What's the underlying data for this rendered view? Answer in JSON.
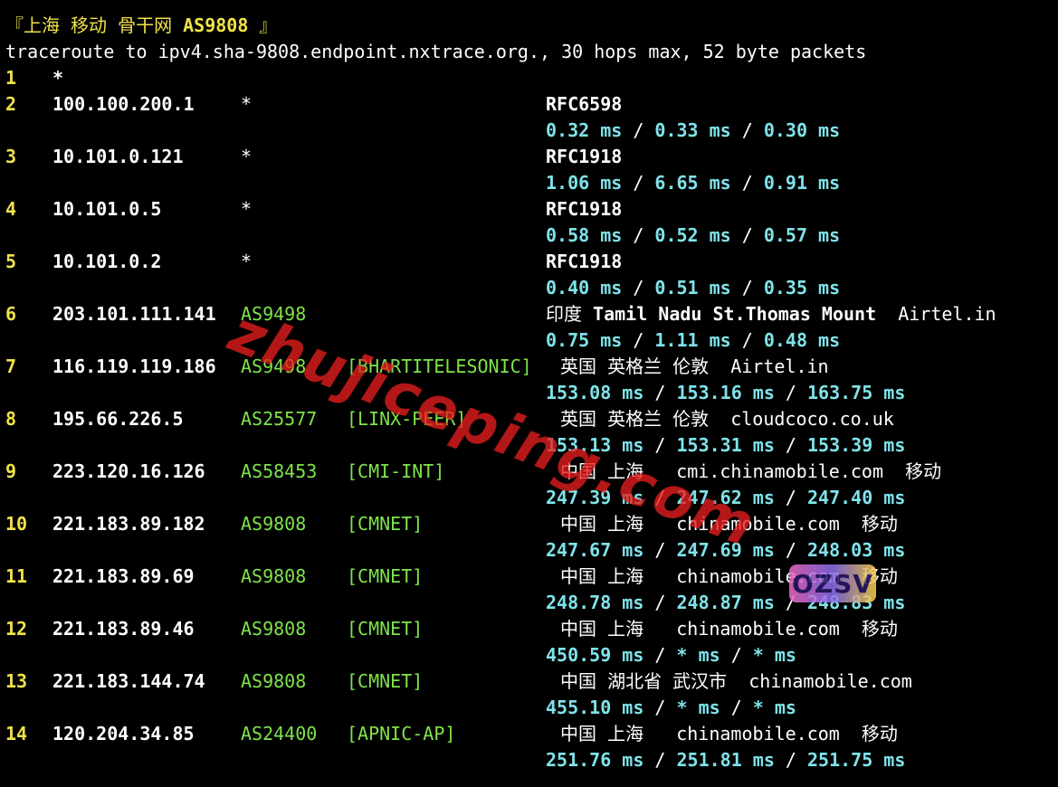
{
  "header": {
    "title_prefix": "『上海 移动 骨干网 ",
    "title_asn": "AS9808",
    "title_suffix": " 』",
    "command": "traceroute to ipv4.sha-9808.endpoint.nxtrace.org., 30 hops max, 52 byte packets"
  },
  "hops": [
    {
      "num": "1",
      "ip": "*"
    },
    {
      "num": "2",
      "ip": "100.100.200.1",
      "star": "*",
      "geo": "RFC6598",
      "t1": "0.32 ms",
      "t2": "0.33 ms",
      "t3": "0.30 ms"
    },
    {
      "num": "3",
      "ip": "10.101.0.121",
      "star": "*",
      "geo": "RFC1918",
      "t1": "1.06 ms",
      "t2": "6.65 ms",
      "t3": "0.91 ms"
    },
    {
      "num": "4",
      "ip": "10.101.0.5",
      "star": "*",
      "geo": "RFC1918",
      "t1": "0.58 ms",
      "t2": "0.52 ms",
      "t3": "0.57 ms"
    },
    {
      "num": "5",
      "ip": "10.101.0.2",
      "star": "*",
      "geo": "RFC1918",
      "t1": "0.40 ms",
      "t2": "0.51 ms",
      "t3": "0.35 ms"
    },
    {
      "num": "6",
      "ip": "203.101.111.141",
      "asn": "AS9498",
      "geo_a": "印度 ",
      "geo_b": "Tamil Nadu St.Thomas Mount",
      "geo_c": "  Airtel.in",
      "t1": "0.75 ms",
      "t2": "1.11 ms",
      "t3": "0.48 ms"
    },
    {
      "num": "7",
      "ip": "116.119.119.186",
      "asn": "AS9498",
      "tag": "[BHARTITELESONIC]",
      "geo": " 英国 英格兰 伦敦  Airtel.in",
      "t1": "153.08 ms",
      "t2": "153.16 ms",
      "t3": "163.75 ms"
    },
    {
      "num": "8",
      "ip": "195.66.226.5",
      "asn": "AS25577",
      "tag": "[LINX-PEER]",
      "geo": " 英国 英格兰 伦敦  cloudcoco.co.uk",
      "t1": "153.13 ms",
      "t2": "153.31 ms",
      "t3": "153.39 ms"
    },
    {
      "num": "9",
      "ip": "223.120.16.126",
      "asn": "AS58453",
      "tag": "[CMI-INT]",
      "geo": " 中国 上海   cmi.chinamobile.com  移动",
      "t1": "247.39 ms",
      "t2": "247.62 ms",
      "t3": "247.40 ms"
    },
    {
      "num": "10",
      "ip": "221.183.89.182",
      "asn": "AS9808",
      "tag": "[CMNET]",
      "geo": " 中国 上海   chinamobile.com  移动",
      "t1": "247.67 ms",
      "t2": "247.69 ms",
      "t3": "248.03 ms"
    },
    {
      "num": "11",
      "ip": "221.183.89.69",
      "asn": "AS9808",
      "tag": "[CMNET]",
      "geo": " 中国 上海   chinamobile.com  移动",
      "t1": "248.78 ms",
      "t2": "248.87 ms",
      "t3": "248.83 ms"
    },
    {
      "num": "12",
      "ip": "221.183.89.46",
      "asn": "AS9808",
      "tag": "[CMNET]",
      "geo": " 中国 上海   chinamobile.com  移动",
      "t1": "450.59 ms",
      "t2": "* ms",
      "t3": "* ms"
    },
    {
      "num": "13",
      "ip": "221.183.144.74",
      "asn": "AS9808",
      "tag": "[CMNET]",
      "geo": " 中国 湖北省 武汉市  chinamobile.com",
      "t1": "455.10 ms",
      "t2": "* ms",
      "t3": "* ms"
    },
    {
      "num": "14",
      "ip": "120.204.34.85",
      "asn": "AS24400",
      "tag": "[APNIC-AP]",
      "geo": " 中国 上海   chinamobile.com  移动",
      "t1": "251.76 ms",
      "t2": "251.81 ms",
      "t3": "251.75 ms"
    }
  ],
  "separator": " / ",
  "watermark": {
    "text": "zhujiceping.com"
  },
  "logo": {
    "text": "OZSV"
  },
  "colors": {
    "background": "#000000",
    "hop_number": "#f0e24a",
    "asn": "#7ee44a",
    "timing": "#7fe3ea",
    "watermark": "#e61e1e"
  }
}
